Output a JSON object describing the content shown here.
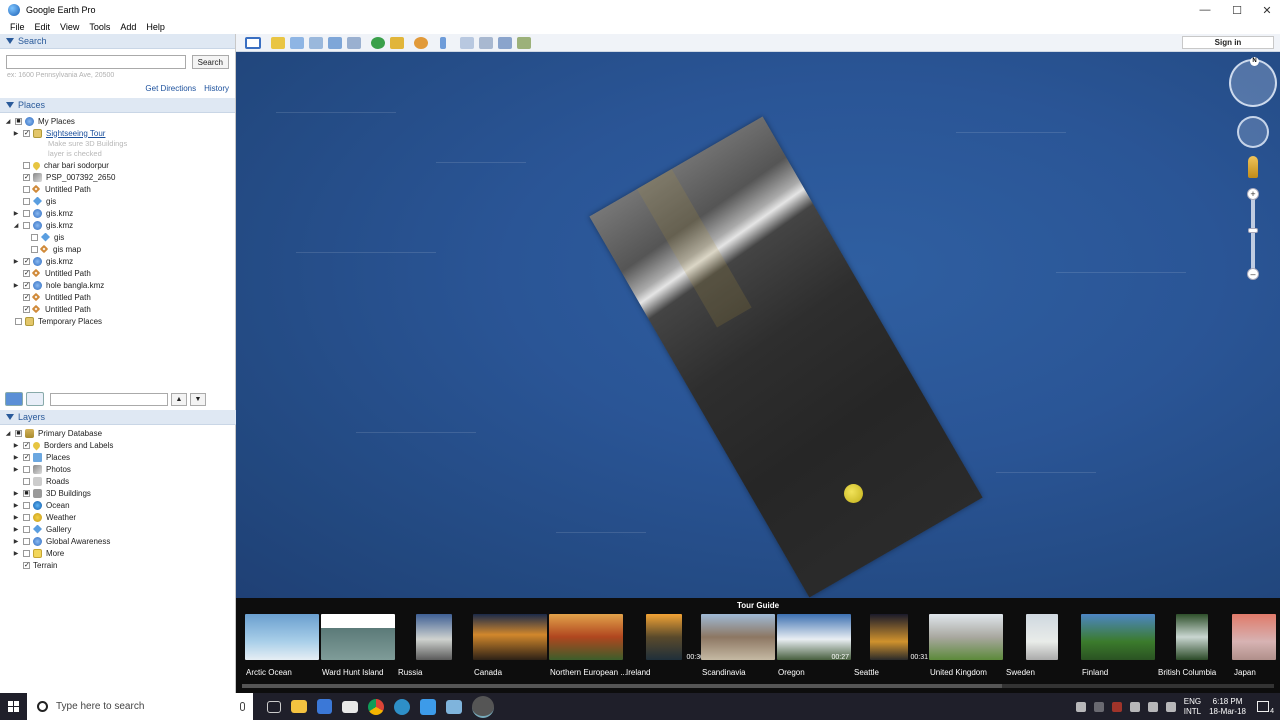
{
  "window": {
    "title": "Google Earth Pro"
  },
  "menu": [
    "File",
    "Edit",
    "View",
    "Tools",
    "Add",
    "Help"
  ],
  "search": {
    "header": "Search",
    "button": "Search",
    "placeholder": "ex: 1600 Pennsylvania Ave, 20500",
    "get_directions": "Get Directions",
    "history": "History"
  },
  "places": {
    "header": "Places",
    "root": "My Places",
    "tour": "Sightseeing Tour",
    "tour_note1": "Make sure 3D Buildings",
    "tour_note2": "layer is checked",
    "items": [
      {
        "label": "char bari  sodorpur"
      },
      {
        "label": "PSP_007392_2650"
      },
      {
        "label": "Untitled Path"
      },
      {
        "label": "gis"
      },
      {
        "label": "gis.kmz"
      },
      {
        "label": "gis.kmz"
      },
      {
        "label": "gis"
      },
      {
        "label": "gis map"
      },
      {
        "label": "gis.kmz"
      },
      {
        "label": "Untitled Path"
      },
      {
        "label": "hole bangla.kmz"
      },
      {
        "label": "Untitled Path"
      },
      {
        "label": "Untitled Path"
      }
    ],
    "temporary": "Temporary Places"
  },
  "layers": {
    "header": "Layers",
    "root": "Primary Database",
    "items": [
      "Borders and Labels",
      "Places",
      "Photos",
      "Roads",
      "3D Buildings",
      "Ocean",
      "Weather",
      "Gallery",
      "Global Awareness",
      "More"
    ],
    "terrain": "Terrain"
  },
  "toolbar": {
    "signin": "Sign in"
  },
  "nav": {
    "north": "N"
  },
  "tour_guide": {
    "title": "Tour Guide",
    "thumbs": [
      {
        "label": "Arctic Ocean",
        "dur": ""
      },
      {
        "label": "Ward Hunt Island",
        "dur": ""
      },
      {
        "label": "Russia",
        "dur": ""
      },
      {
        "label": "Canada",
        "dur": ""
      },
      {
        "label": "Northern European ...",
        "dur": ""
      },
      {
        "label": "Ireland",
        "dur": "00:30"
      },
      {
        "label": "Scandinavia",
        "dur": ""
      },
      {
        "label": "Oregon",
        "dur": "00:27"
      },
      {
        "label": "Seattle",
        "dur": "00:31"
      },
      {
        "label": "United Kingdom",
        "dur": ""
      },
      {
        "label": "Sweden",
        "dur": ""
      },
      {
        "label": "Finland",
        "dur": ""
      },
      {
        "label": "British Columbia",
        "dur": ""
      },
      {
        "label": "Japan",
        "dur": ""
      }
    ]
  },
  "taskbar": {
    "search_placeholder": "Type here to search",
    "lang1": "ENG",
    "lang2": "INTL",
    "time": "6:18 PM",
    "date": "18-Mar-18",
    "notif_count": "4"
  }
}
